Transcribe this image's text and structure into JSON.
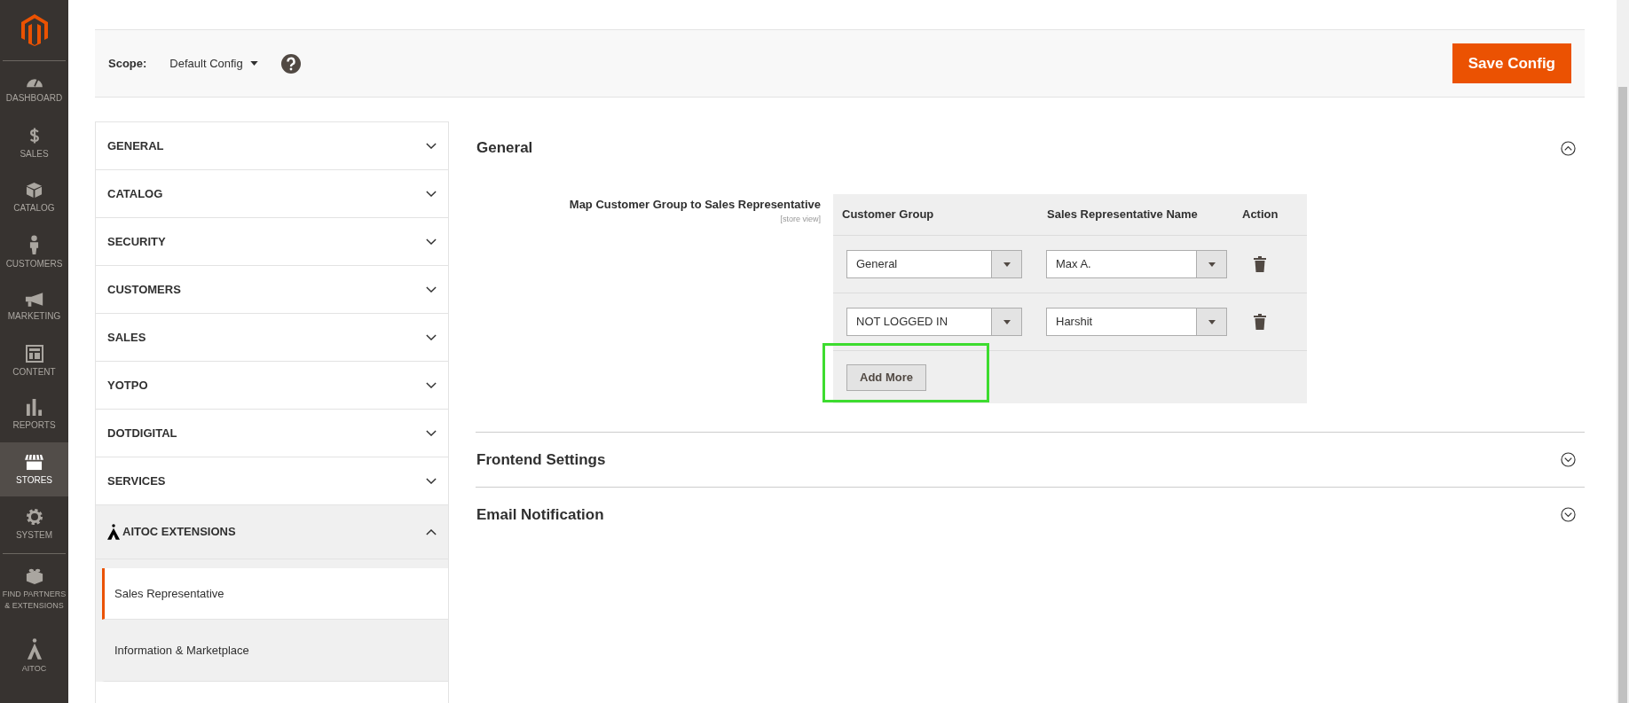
{
  "sidebar": {
    "items": [
      {
        "label": "DASHBOARD",
        "selected": false
      },
      {
        "label": "SALES",
        "selected": false
      },
      {
        "label": "CATALOG",
        "selected": false
      },
      {
        "label": "CUSTOMERS",
        "selected": false
      },
      {
        "label": "MARKETING",
        "selected": false
      },
      {
        "label": "CONTENT",
        "selected": false
      },
      {
        "label": "REPORTS",
        "selected": false
      },
      {
        "label": "STORES",
        "selected": true
      },
      {
        "label": "SYSTEM",
        "selected": false
      },
      {
        "label": "FIND PARTNERS & EXTENSIONS",
        "selected": false
      },
      {
        "label": "AITOC",
        "selected": false
      }
    ]
  },
  "scope": {
    "label": "Scope:",
    "value": "Default Config"
  },
  "save_button": "Save Config",
  "config_menu": [
    {
      "label": "GENERAL",
      "expanded": false
    },
    {
      "label": "CATALOG",
      "expanded": false
    },
    {
      "label": "SECURITY",
      "expanded": false
    },
    {
      "label": "CUSTOMERS",
      "expanded": false
    },
    {
      "label": "SALES",
      "expanded": false
    },
    {
      "label": "YOTPO",
      "expanded": false
    },
    {
      "label": "DOTDIGITAL",
      "expanded": false
    },
    {
      "label": "SERVICES",
      "expanded": false
    },
    {
      "label": "AITOC EXTENSIONS",
      "expanded": true,
      "children": [
        {
          "label": "Sales Representative",
          "selected": true
        },
        {
          "label": "Information & Marketplace",
          "selected": false
        }
      ]
    }
  ],
  "sections": [
    {
      "title": "General",
      "expanded": true,
      "field": {
        "label": "Map Customer Group to Sales Representative",
        "scope": "[store view]",
        "columns": [
          "Customer Group",
          "Sales Representative Name",
          "Action"
        ],
        "rows": [
          {
            "customer_group": "General",
            "sales_representative": "Max A."
          },
          {
            "customer_group": "NOT LOGGED IN",
            "sales_representative": "Harshit"
          }
        ],
        "add_button": "Add More"
      }
    },
    {
      "title": "Frontend Settings",
      "expanded": false
    },
    {
      "title": "Email Notification",
      "expanded": false
    }
  ]
}
